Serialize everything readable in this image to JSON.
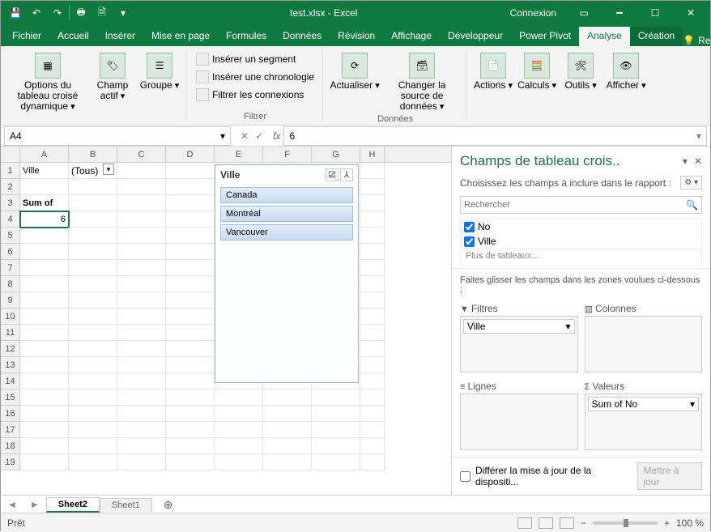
{
  "titlebar": {
    "title": "test.xlsx - Excel",
    "signin": "Connexion"
  },
  "ribbon_tabs": [
    "Fichier",
    "Accueil",
    "Insérer",
    "Mise en page",
    "Formules",
    "Données",
    "Révision",
    "Affichage",
    "Développeur",
    "Power Pivot",
    "Analyse",
    "Création"
  ],
  "ribbon_search": "Recherch",
  "ribbon": {
    "pivotOptions": "Options du tableau croisé dynamique",
    "activeField": "Champ actif",
    "group": "Groupe",
    "insertSlicer": "Insérer un segment",
    "insertTimeline": "Insérer une chronologie",
    "filterConnections": "Filtrer les connexions",
    "filterLabel": "Filtrer",
    "refresh": "Actualiser",
    "changeSource": "Changer la source de données",
    "dataLabel": "Données",
    "actions": "Actions",
    "calculations": "Calculs",
    "tools": "Outils",
    "show": "Afficher"
  },
  "name_box": "A4",
  "formula_value": "6",
  "grid": {
    "columns": [
      "A",
      "B",
      "C",
      "D",
      "E",
      "F",
      "G",
      "H"
    ],
    "a1": "Ville",
    "b1": "(Tous)",
    "a3": "Sum of No",
    "a4": "6"
  },
  "slicer": {
    "title": "Ville",
    "items": [
      "Canada",
      "Montréal",
      "Vancouver"
    ]
  },
  "pane": {
    "title": "Champs de tableau crois..",
    "subtitle": "Choisissez les champs à inclure dans le rapport :",
    "search_placeholder": "Rechercher",
    "fields": [
      "No",
      "Ville"
    ],
    "more": "Plus de tableaux...",
    "drag_hint": "Faites glisser les champs dans les zones voulues ci-dessous :",
    "area_filters": "Filtres",
    "area_columns": "Colonnes",
    "area_rows": "Lignes",
    "area_values": "Valeurs",
    "filter_chip": "Ville",
    "value_chip": "Sum of No",
    "defer": "Différer la mise à jour de la dispositi...",
    "update": "Mettre à jour"
  },
  "sheets": {
    "active": "Sheet2",
    "other": "Sheet1"
  },
  "status": {
    "ready": "Prêt",
    "zoom": "100 %"
  }
}
